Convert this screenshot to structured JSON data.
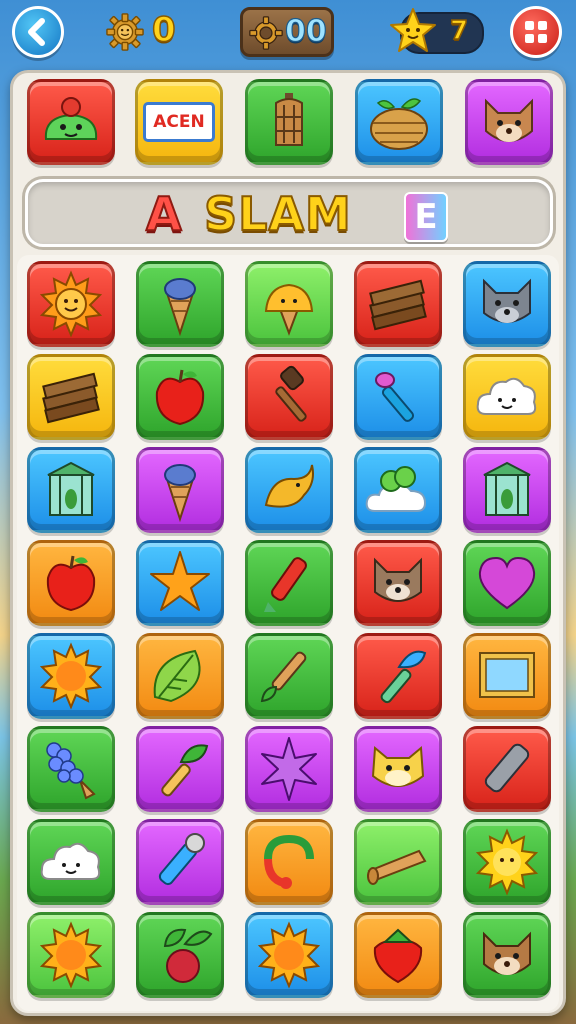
{
  "hud": {
    "back_label": "back",
    "gear_count": "0",
    "gear_panel_count": "00",
    "star_count": "7",
    "menu_label": "menu"
  },
  "top_row": [
    {
      "icon": "green-blob-creature-icon",
      "color": "red"
    },
    {
      "icon": "acen-sign-icon",
      "color": "yellow",
      "text": "ACEN"
    },
    {
      "icon": "lantern-icon",
      "color": "green"
    },
    {
      "icon": "fruit-basket-icon",
      "color": "blue"
    },
    {
      "icon": "fox-face-icon",
      "color": "purple"
    }
  ],
  "word": {
    "letter_a": "A",
    "slam": "SLAM",
    "letter_e": "E"
  },
  "grid": [
    [
      "sun-face-icon",
      "ice-cream-cone-icon",
      "creature-cone-icon",
      "wood-planks-icon",
      "wolf-face-icon"
    ],
    [
      "wood-planks-icon",
      "apple-icon",
      "hammer-icon",
      "paintbrush-icon",
      "cloud-face-icon"
    ],
    [
      "bird-cage-icon",
      "ice-cream-cone-icon",
      "yellow-bird-icon",
      "cloud-bush-icon",
      "bird-cage-icon"
    ],
    [
      "apple-icon",
      "orange-star-icon",
      "crayon-icon",
      "raccoon-face-icon",
      "heart-icon"
    ],
    [
      "sun-icon",
      "leaf-icon",
      "paint-brush-icon",
      "blue-brush-icon",
      "picture-frame-icon"
    ],
    [
      "grapes-cone-icon",
      "green-brush-icon",
      "purple-star-icon",
      "hamster-face-icon",
      "gray-marker-icon"
    ],
    [
      "cloud-face-icon",
      "flashlight-icon",
      "magnet-icon",
      "horn-icon",
      "sun-flower-icon"
    ],
    [
      "sun-icon",
      "berry-leaves-icon",
      "sun-icon",
      "strawberry-icon",
      "fox-face-icon"
    ]
  ],
  "grid_colors": [
    [
      "red",
      "green",
      "lgreen",
      "red",
      "blue"
    ],
    [
      "yellow",
      "green",
      "red",
      "blue",
      "yellow"
    ],
    [
      "blue",
      "purple",
      "blue",
      "blue",
      "purple"
    ],
    [
      "orange",
      "blue",
      "green",
      "red",
      "green"
    ],
    [
      "blue",
      "orange",
      "green",
      "red",
      "orange"
    ],
    [
      "green",
      "purple",
      "purple",
      "purple",
      "red"
    ],
    [
      "green",
      "purple",
      "orange",
      "lgreen",
      "green"
    ],
    [
      "lgreen",
      "green",
      "blue",
      "orange",
      "green"
    ]
  ]
}
